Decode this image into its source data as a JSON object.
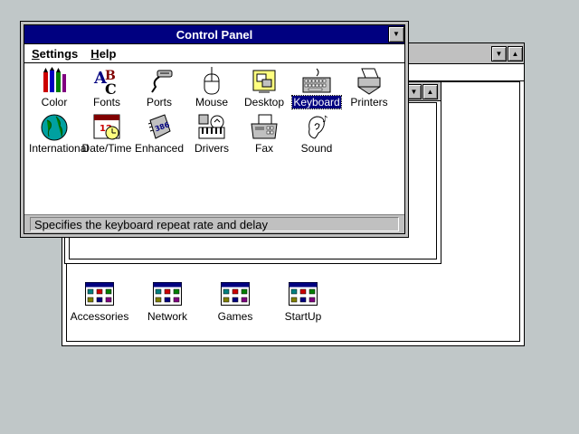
{
  "colors": {
    "desktop": "#c0c7c8",
    "title_active": "#000080",
    "selection": "#000080",
    "face": "#c0c0c0"
  },
  "control_panel": {
    "title": "Control Panel",
    "menu": [
      {
        "label": "Settings"
      },
      {
        "label": "Help"
      }
    ],
    "icons": [
      {
        "label": "Color",
        "icon": "color-crayons-icon"
      },
      {
        "label": "Fonts",
        "icon": "fonts-icon"
      },
      {
        "label": "Ports",
        "icon": "ports-plug-icon"
      },
      {
        "label": "Mouse",
        "icon": "mouse-icon"
      },
      {
        "label": "Desktop",
        "icon": "desktop-icon"
      },
      {
        "label": "Keyboard",
        "icon": "keyboard-icon",
        "selected": true
      },
      {
        "label": "Printers",
        "icon": "printer-icon"
      },
      {
        "label": "International",
        "icon": "globe-icon"
      },
      {
        "label": "Date/Time",
        "icon": "calendar-clock-icon"
      },
      {
        "label": "Enhanced",
        "icon": "chip-386-icon"
      },
      {
        "label": "Drivers",
        "icon": "drivers-icon"
      },
      {
        "label": "Fax",
        "icon": "fax-icon"
      },
      {
        "label": "Sound",
        "icon": "sound-ear-icon"
      }
    ],
    "status_text": "Specifies the keyboard repeat rate and delay"
  },
  "program_manager": {
    "groups": [
      {
        "label": "Accessories",
        "icon": "program-group-icon"
      },
      {
        "label": "Network",
        "icon": "program-group-icon"
      },
      {
        "label": "Games",
        "icon": "program-group-icon"
      },
      {
        "label": "StartUp",
        "icon": "program-group-icon"
      }
    ]
  }
}
